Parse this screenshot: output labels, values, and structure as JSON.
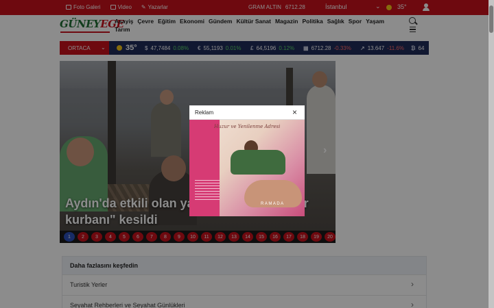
{
  "topbar": {
    "links": [
      {
        "label": "Foto Galeri",
        "icon": "camera-icon"
      },
      {
        "label": "Video",
        "icon": "video-icon"
      },
      {
        "label": "Yazarlar",
        "icon": "pen-icon"
      }
    ],
    "gold_label": "GRAM ALTIN",
    "gold_value": "6712.28",
    "city": "İstanbul",
    "temperature": "35°"
  },
  "header": {
    "logo_part1": "GÜNEY",
    "logo_part2": "EGE",
    "nav": [
      "Asayiş",
      "Çevre",
      "Eğitim",
      "Ekonomi",
      "Gündem",
      "Kültür Sanat",
      "Magazin",
      "Politika",
      "Sağlık",
      "Spor",
      "Yaşam",
      "Tarım"
    ]
  },
  "ticker": {
    "city": "ORTACA",
    "temperature": "35°",
    "items": [
      {
        "symbol": "$",
        "value": "47,7484",
        "change": "0.08%",
        "dir": "up"
      },
      {
        "symbol": "€",
        "value": "55,1193",
        "change": "0.01%",
        "dir": "up"
      },
      {
        "symbol": "£",
        "value": "64,5196",
        "change": "0.12%",
        "dir": "up"
      },
      {
        "symbol": "▦",
        "value": "6712.28",
        "change": "-0.33%",
        "dir": "down"
      },
      {
        "symbol": "↗",
        "value": "13.647",
        "change": "-11.6%",
        "dir": "down"
      },
      {
        "symbol": "₿",
        "value": "64",
        "change": "",
        "dir": "up"
      }
    ]
  },
  "slider": {
    "headline_left": "Aydın'da etkili olan ya",
    "headline_right": "r",
    "headline_line2": "kurbanı\" kesildi",
    "pages": [
      "1",
      "2",
      "3",
      "4",
      "5",
      "6",
      "7",
      "8",
      "9",
      "10",
      "11",
      "12",
      "13",
      "14",
      "15",
      "16",
      "17",
      "18",
      "19",
      "20"
    ],
    "active_page": "1"
  },
  "modal": {
    "title": "Reklam",
    "close": "×",
    "ad_title": "Huzur ve Yenilenme Adresi",
    "ad_brand": "RAMADA"
  },
  "explore": {
    "title": "Daha fazlasını keşfedin",
    "items": [
      "Turistik Yerler",
      "Seyahat Rehberleri ve Seyahat Günlükleri"
    ]
  },
  "colors": {
    "brand_red": "#c8111c",
    "ticker_navy": "#202c5a",
    "logo_green": "#1f6d33"
  }
}
